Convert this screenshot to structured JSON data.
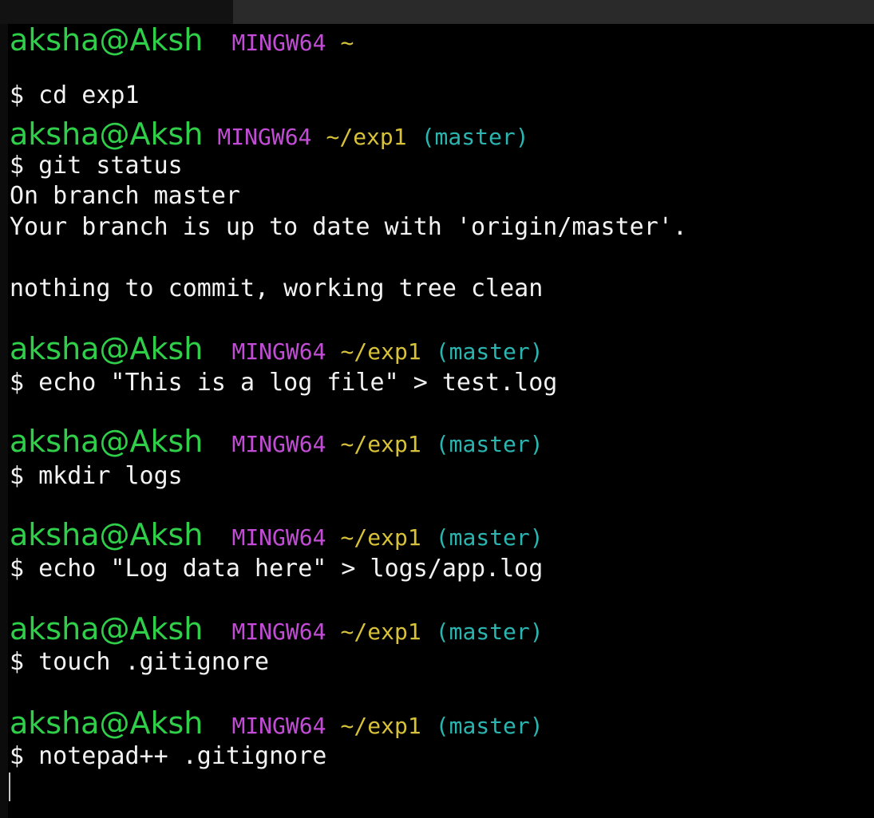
{
  "prompt": {
    "user": "aksha@Aksh",
    "host": "MINGW64"
  },
  "blocks": [
    {
      "path": "~",
      "branch": "",
      "command": "$ cd exp1",
      "output": []
    },
    {
      "path": "~/exp1",
      "branch": "(master)",
      "command": "$ git status",
      "output": [
        "On branch master",
        "Your branch is up to date with 'origin/master'.",
        "",
        "nothing to commit, working tree clean"
      ]
    },
    {
      "path": "~/exp1",
      "branch": "(master)",
      "command": "$ echo \"This is a log file\" > test.log",
      "output": []
    },
    {
      "path": "~/exp1",
      "branch": "(master)",
      "command": "$ mkdir logs",
      "output": []
    },
    {
      "path": "~/exp1",
      "branch": "(master)",
      "command": "$ echo \"Log data here\" > logs/app.log",
      "output": []
    },
    {
      "path": "~/exp1",
      "branch": "(master)",
      "command": "$ touch .gitignore",
      "output": []
    },
    {
      "path": "~/exp1",
      "branch": "(master)",
      "command": "$ notepad++ .gitignore",
      "output": []
    }
  ],
  "colors": {
    "user": "#2fcf4a",
    "host": "#c24cd6",
    "path": "#d8c23a",
    "branch": "#2bb5b0",
    "text": "#f2f2f2",
    "background": "#000000"
  }
}
